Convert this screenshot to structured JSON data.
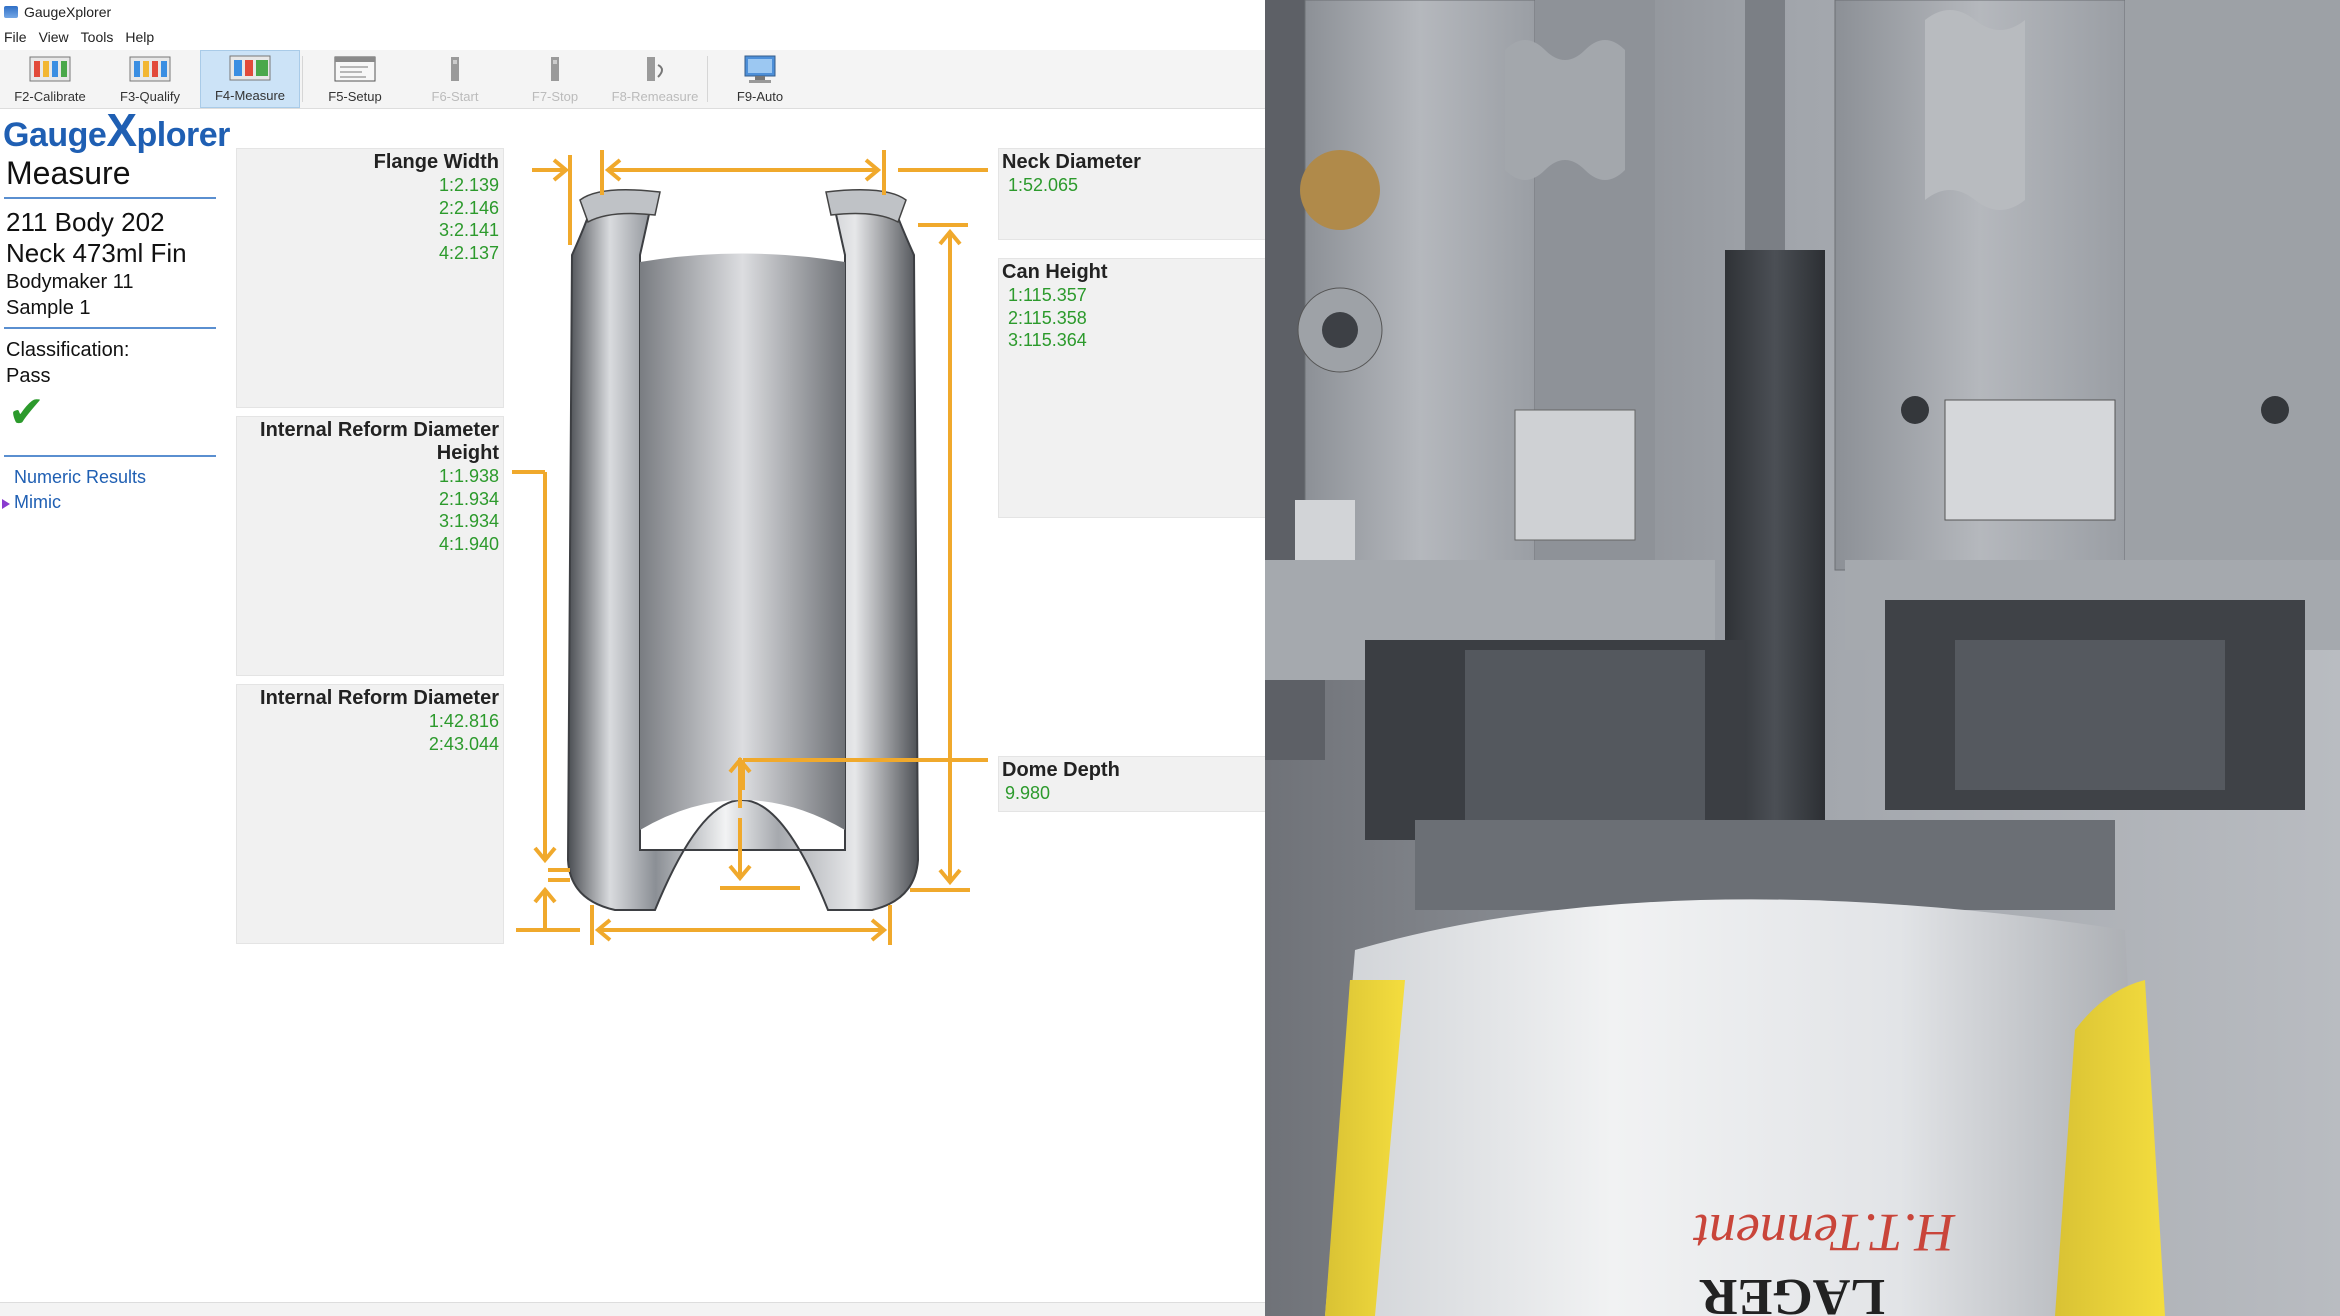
{
  "window": {
    "title": "GaugeXplorer"
  },
  "menu": [
    "File",
    "View",
    "Tools",
    "Help"
  ],
  "toolbar": [
    {
      "label": "F2-Calibrate",
      "icon": "calibrate-icon",
      "state": "normal"
    },
    {
      "label": "F3-Qualify",
      "icon": "qualify-icon",
      "state": "normal"
    },
    {
      "label": "F4-Measure",
      "icon": "measure-icon",
      "state": "active"
    },
    {
      "label": "F5-Setup",
      "icon": "setup-icon",
      "state": "normal"
    },
    {
      "label": "F6-Start",
      "icon": "start-icon",
      "state": "disabled"
    },
    {
      "label": "F7-Stop",
      "icon": "stop-icon",
      "state": "disabled"
    },
    {
      "label": "F8-Remeasure",
      "icon": "remeasure-icon",
      "state": "disabled"
    },
    {
      "label": "F9-Auto",
      "icon": "auto-icon",
      "state": "normal"
    }
  ],
  "sidebar": {
    "logo_a": "Gauge",
    "logo_b": "X",
    "logo_c": "plorer",
    "mode": "Measure",
    "job_line1": "211 Body 202",
    "job_line2": "Neck 473ml Fin",
    "machine": "Bodymaker 11",
    "sample": "Sample 1",
    "class_label": "Classification:",
    "class_value": "Pass",
    "nav": [
      {
        "label": "Numeric Results",
        "current": false
      },
      {
        "label": "Mimic",
        "current": true
      }
    ]
  },
  "panels": {
    "flange_width": {
      "label": "Flange Width",
      "values": [
        "1:2.139",
        "2:2.146",
        "3:2.141",
        "4:2.137"
      ]
    },
    "ird_height": {
      "label_1": "Internal Reform Diameter",
      "label_2": "Height",
      "values": [
        "1:1.938",
        "2:1.934",
        "3:1.934",
        "4:1.940"
      ]
    },
    "ird": {
      "label": "Internal Reform Diameter",
      "values": [
        "1:42.816",
        "2:43.044"
      ]
    },
    "neck_diameter": {
      "label": "Neck Diameter",
      "values": [
        "1:52.065"
      ]
    },
    "can_height": {
      "label": "Can Height",
      "values": [
        "1:115.357",
        "2:115.358",
        "3:115.364"
      ]
    },
    "dome_depth": {
      "label": "Dome Depth",
      "values": [
        "9.980"
      ]
    }
  },
  "colors": {
    "accent": "#1f5fb3",
    "value": "#2c9a2c",
    "dimension": "#f0a92c",
    "active_tool": "#cce3f7"
  },
  "photo": {
    "brand_script": "H.T.Tennent",
    "brand_word": "LAGER"
  }
}
